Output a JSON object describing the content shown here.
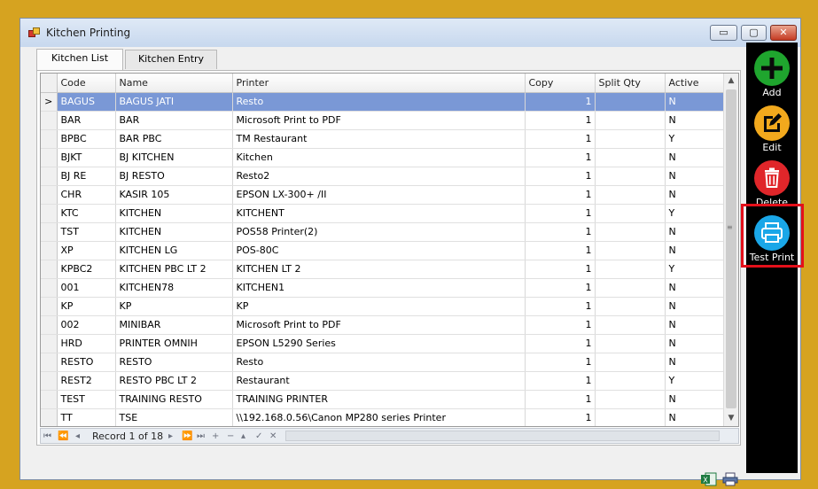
{
  "window": {
    "title": "Kitchen Printing",
    "min_label": "▭",
    "max_label": "▢",
    "close_label": "✕"
  },
  "tabs": [
    {
      "label": "Kitchen List"
    },
    {
      "label": "Kitchen Entry"
    }
  ],
  "grid": {
    "columns": [
      "Code",
      "Name",
      "Printer",
      "Copy",
      "Split Qty",
      "Active"
    ],
    "row_indicator": ">",
    "rows": [
      [
        "BAGUS",
        "BAGUS JATI",
        "Resto",
        "1",
        "",
        "N"
      ],
      [
        "BAR",
        "BAR",
        "Microsoft Print to PDF",
        "1",
        "",
        "N"
      ],
      [
        "BPBC",
        "BAR PBC",
        "TM Restaurant",
        "1",
        "",
        "Y"
      ],
      [
        "BJKT",
        "BJ KITCHEN",
        "Kitchen",
        "1",
        "",
        "N"
      ],
      [
        "BJ RE",
        "BJ RESTO",
        "Resto2",
        "1",
        "",
        "N"
      ],
      [
        "CHR",
        "KASIR 105",
        "EPSON LX-300+ /II",
        "1",
        "",
        "N"
      ],
      [
        "KTC",
        "KITCHEN",
        "KITCHENT",
        "1",
        "",
        "Y"
      ],
      [
        "TST",
        "KITCHEN",
        "POS58 Printer(2)",
        "1",
        "",
        "N"
      ],
      [
        "XP",
        "KITCHEN LG",
        "POS-80C",
        "1",
        "",
        "N"
      ],
      [
        "KPBC2",
        "KITCHEN PBC LT 2",
        "KITCHEN LT 2",
        "1",
        "",
        "Y"
      ],
      [
        "001",
        "KITCHEN78",
        "KITCHEN1",
        "1",
        "",
        "N"
      ],
      [
        "KP",
        "KP",
        "KP",
        "1",
        "",
        "N"
      ],
      [
        "002",
        "MINIBAR",
        "Microsoft Print to PDF",
        "1",
        "",
        "N"
      ],
      [
        "HRD",
        "PRINTER OMNIH",
        "EPSON L5290 Series",
        "1",
        "",
        "N"
      ],
      [
        "RESTO",
        "RESTO",
        "Resto",
        "1",
        "",
        "N"
      ],
      [
        "REST2",
        "RESTO PBC LT 2",
        "Restaurant",
        "1",
        "",
        "Y"
      ],
      [
        "TEST",
        "TRAINING RESTO",
        "TRAINING PRINTER",
        "1",
        "",
        "N"
      ],
      [
        "TT",
        "TSE",
        "\\\\192.168.0.56\\Canon MP280 series Printer",
        "1",
        "",
        "N"
      ]
    ],
    "selected_row": 0
  },
  "navigator": {
    "record_text": "Record 1 of 18"
  },
  "sidebar": {
    "buttons": [
      {
        "label": "Add",
        "color": "#1fa52e"
      },
      {
        "label": "Edit",
        "color": "#f2a91d"
      },
      {
        "label": "Delete",
        "color": "#e0262a"
      },
      {
        "label": "Test Print",
        "color": "#1aa7e8"
      }
    ],
    "highlight_color": "#e4101a"
  }
}
